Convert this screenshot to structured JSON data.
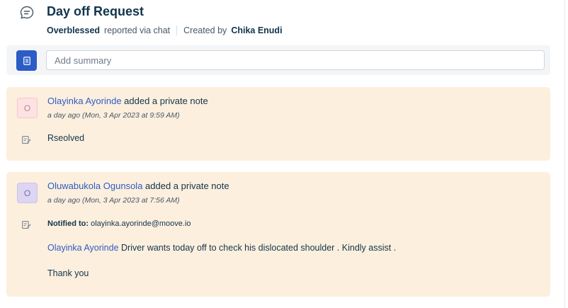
{
  "ticket": {
    "title": "Day off Request",
    "requester": "Overblessed",
    "reported_via": "reported via chat",
    "created_by_label": "Created by",
    "created_by": "Chika Enudi"
  },
  "summary": {
    "placeholder": "Add summary"
  },
  "notes": [
    {
      "avatar_initial": "O",
      "author": "Olayinka Ayorinde",
      "action": "added a private note",
      "time": "a day ago (Mon, 3 Apr 2023 at 9:59 AM)",
      "body": "Rseolved"
    },
    {
      "avatar_initial": "O",
      "author": "Oluwabukola Ogunsola",
      "action": "added a private note",
      "time": "a day ago (Mon, 3 Apr 2023 at 7:56 AM)",
      "notified_label": "Notified to:",
      "notified_to": "olayinka.ayorinde@moove.io",
      "mention": "Olayinka Ayorinde",
      "body": "Driver wants today off to check his dislocated shoulder . Kindly assist .",
      "closing": "Thank you"
    }
  ],
  "icons": {
    "chat": "chat-bubble-icon",
    "summary": "document-icon",
    "note": "edit-note-icon"
  },
  "colors": {
    "accent": "#2c5cc5",
    "note_bg": "#fdefdd",
    "text": "#12344d"
  }
}
